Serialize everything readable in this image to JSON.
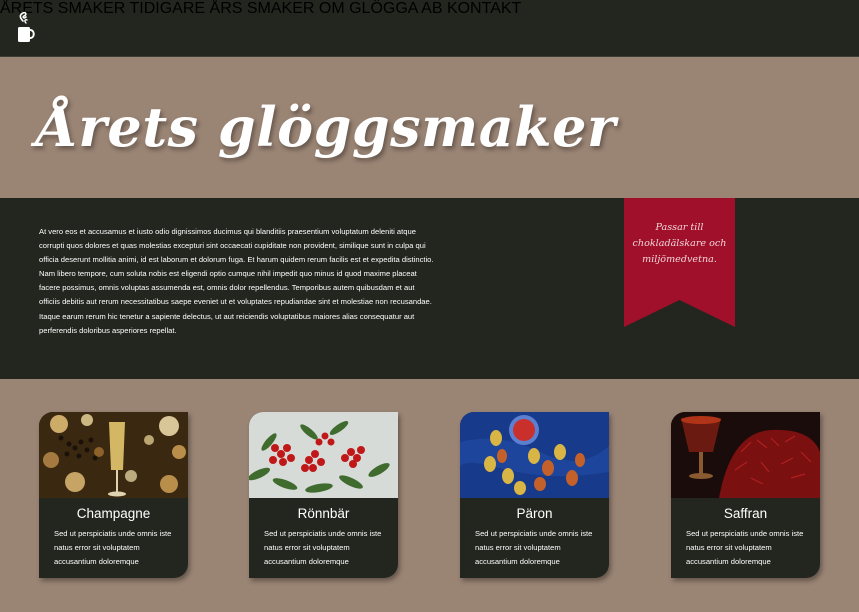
{
  "nav": {
    "items": [
      {
        "label": "ÅRETS SMAKER"
      },
      {
        "label": "TIDIGARE ÅRS SMAKER"
      },
      {
        "label": "OM GLÖGGA AB"
      },
      {
        "label": "KONTAKT"
      }
    ]
  },
  "hero": {
    "title": "Årets glöggsmaker"
  },
  "intro": {
    "text": "At vero eos et accusamus et iusto odio dignissimos ducimus qui blanditiis praesentium voluptatum deleniti atque corrupti quos dolores et quas molestias excepturi sint occaecati cupiditate non provident, similique sunt in culpa qui officia deserunt mollitia animi, id est laborum et dolorum fuga. Et harum quidem rerum facilis est et expedita distinctio. Nam libero tempore, cum soluta nobis est eligendi optio cumque nihil impedit quo minus id quod maxime placeat facere possimus, omnis voluptas assumenda est, omnis dolor repellendus. Temporibus autem quibusdam et aut officiis debitis aut rerum necessitatibus saepe eveniet ut et voluptates repudiandae sint et molestiae non recusandae. Itaque earum rerum hic tenetur a sapiente delectus, ut aut reiciendis voluptatibus maiores alias consequatur aut perferendis doloribus asperiores repellat."
  },
  "ribbon": {
    "text": "Passar till chokladälskare och miljömedvetna.",
    "color": "#a0102a"
  },
  "cards": [
    {
      "title": "Champagne",
      "description": "Sed ut perspiciatis unde omnis iste natus error sit voluptatem accusantium doloremque",
      "image": "champagne-photo"
    },
    {
      "title": "Rönnbär",
      "description": "Sed ut perspiciatis unde omnis iste natus error sit voluptatem accusantium doloremque",
      "image": "rowanberry-photo"
    },
    {
      "title": "Päron",
      "description": "Sed ut perspiciatis unde omnis iste natus error sit voluptatem accusantium doloremque",
      "image": "pear-photo"
    },
    {
      "title": "Saffran",
      "description": "Sed ut perspiciatis unde omnis iste natus error sit voluptatem accusantium doloremque",
      "image": "saffron-photo"
    }
  ],
  "colors": {
    "dark": "#23261f",
    "background": "#9a8474",
    "accent": "#a0102a"
  }
}
